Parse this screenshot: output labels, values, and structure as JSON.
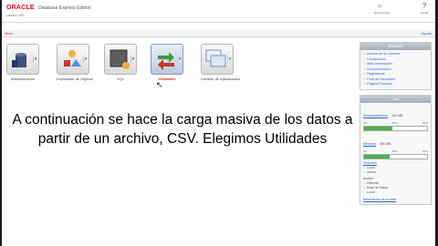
{
  "header": {
    "logo": "ORACLE",
    "product": "Database Express Edition",
    "user_line": "Usuario: HR",
    "breadcrumb": "Inicio",
    "help_link": "Ayuda",
    "home_label": "Inicio",
    "icons": [
      {
        "name": "logout-icon",
        "label": "Desconectar"
      },
      {
        "name": "help-icon",
        "label": "Ayuda"
      }
    ]
  },
  "apps": [
    {
      "name": "administracion",
      "label": "Administración",
      "active": false
    },
    {
      "name": "explorador-objetos",
      "label": "Explorador de Objetos",
      "active": false
    },
    {
      "name": "sql",
      "label": "SQL",
      "active": false
    },
    {
      "name": "utilidades",
      "label": "Utilidades",
      "active": true
    },
    {
      "name": "creador-aplicaciones",
      "label": "Creador de Aplicaciones",
      "active": false
    }
  ],
  "caption": "A continuación se hace la carga masiva de los datos a partir de un archivo, CSV. Elegimos Utilidades",
  "tasks": {
    "title": "Enlaces",
    "items": [
      "Acerca de la Licencia",
      "Introducción",
      "Más Información",
      "Documentación",
      "Registrarse",
      "Foro de Discusión",
      "Página Principal"
    ]
  },
  "usage": {
    "title": "Uso",
    "storage_label": "Almacenamiento",
    "storage_value": "100 MB",
    "storage_pct": 0.45,
    "memory_label": "Memoria",
    "memory_value": "480 MB",
    "memory_pct": 0.4,
    "scale": [
      "0%",
      "80%",
      "90%"
    ],
    "sessions_label": "Sesiones",
    "sessions_items": [
      "Local",
      "Activa"
    ],
    "access_label": "Acceso",
    "access_items": [
      "Historial",
      "Base de Datos",
      "Local"
    ],
    "footer": "Información de la base"
  }
}
